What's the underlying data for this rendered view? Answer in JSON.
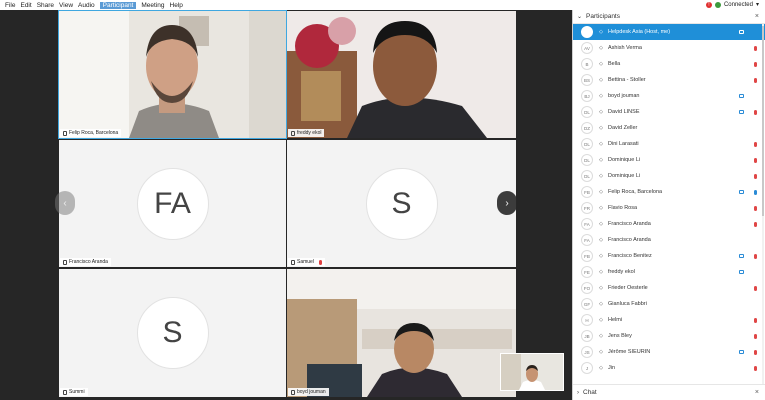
{
  "menu": [
    "File",
    "Edit",
    "Share",
    "View",
    "Audio",
    "Participant",
    "Meeting",
    "Help"
  ],
  "menu_selected": 5,
  "status": {
    "label": "Connected"
  },
  "video": {
    "tiles": [
      {
        "name": "Felip Roca, Barcelona",
        "initials": "",
        "type": "video"
      },
      {
        "name": "freddy ekol",
        "initials": "",
        "type": "video"
      },
      {
        "name": "Francisco Aranda",
        "initials": "FA",
        "type": "avatar"
      },
      {
        "name": "Samuel",
        "initials": "S",
        "type": "avatar",
        "muted": true
      },
      {
        "name": "Summi",
        "initials": "S",
        "type": "avatar"
      },
      {
        "name": "boyd jouman",
        "initials": "",
        "type": "video"
      }
    ],
    "nav_prev": "‹",
    "nav_next": "›"
  },
  "sidebar": {
    "participants_label": "Participants",
    "chat_label": "Chat",
    "close": "×",
    "participants": [
      {
        "initials": "",
        "name": "Helpdesk Asia  (Host, me)",
        "me": true,
        "cam": true,
        "mic": "none"
      },
      {
        "initials": "AV",
        "name": "Ashish Verma",
        "cam": false,
        "mic": "red"
      },
      {
        "initials": "B",
        "name": "Bella",
        "cam": false,
        "mic": "red"
      },
      {
        "initials": "BS",
        "name": "Bettina - Stoller",
        "cam": false,
        "mic": "red"
      },
      {
        "initials": "BJ",
        "name": "boyd jouman",
        "cam": true,
        "mic": "none"
      },
      {
        "initials": "DL",
        "name": "David LINSE",
        "cam": true,
        "mic": "red"
      },
      {
        "initials": "DZ",
        "name": "David Zeller",
        "cam": false,
        "mic": "none"
      },
      {
        "initials": "DL",
        "name": "Dini Larasati",
        "cam": false,
        "mic": "red"
      },
      {
        "initials": "DL",
        "name": "Dominique Li",
        "cam": false,
        "mic": "red"
      },
      {
        "initials": "DL",
        "name": "Dominique Li",
        "cam": false,
        "mic": "red"
      },
      {
        "initials": "FB",
        "name": "Felip Roca, Barcelona",
        "cam": true,
        "mic": "blue"
      },
      {
        "initials": "FR",
        "name": "Flavio Rosa",
        "cam": false,
        "mic": "red"
      },
      {
        "initials": "FA",
        "name": "Francisco Aranda",
        "cam": false,
        "mic": "red"
      },
      {
        "initials": "FA",
        "name": "Francisco Aranda",
        "cam": false,
        "mic": "none"
      },
      {
        "initials": "FB",
        "name": "Francisco Benitez",
        "cam": true,
        "mic": "red"
      },
      {
        "initials": "FE",
        "name": "freddy ekol",
        "cam": true,
        "mic": "none"
      },
      {
        "initials": "FO",
        "name": "Frieder Oesterle",
        "cam": false,
        "mic": "red"
      },
      {
        "initials": "GF",
        "name": "Gianluca Fabbri",
        "cam": false,
        "mic": "none"
      },
      {
        "initials": "H",
        "name": "Helmi",
        "cam": false,
        "mic": "red"
      },
      {
        "initials": "JB",
        "name": "Jens Bley",
        "cam": false,
        "mic": "red"
      },
      {
        "initials": "JS",
        "name": "Jérôme SIEURIN",
        "cam": true,
        "mic": "red"
      },
      {
        "initials": "J",
        "name": "Jin",
        "cam": false,
        "mic": "red"
      }
    ]
  },
  "colors": {
    "accent": "#1f8fd8",
    "stage": "#262626",
    "mic_muted": "#e04646"
  },
  "icons": {
    "collapse": "chevron-down-icon",
    "close": "close-icon",
    "connection": "connection-status-icon"
  }
}
